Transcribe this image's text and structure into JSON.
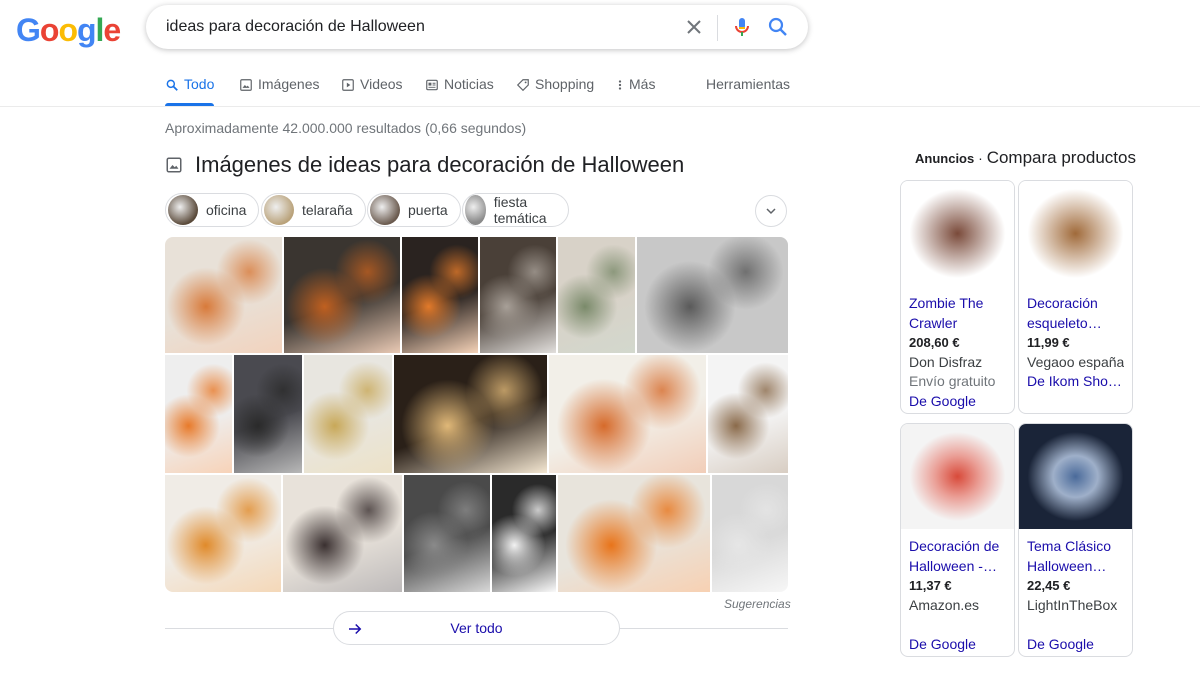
{
  "logo": {
    "letters": [
      "G",
      "o",
      "o",
      "g",
      "l",
      "e"
    ],
    "colors": [
      "#4285F4",
      "#EA4335",
      "#FBBC05",
      "#4285F4",
      "#34A853",
      "#EA4335"
    ]
  },
  "search": {
    "query": "ideas para decoración de Halloween"
  },
  "tabs": [
    {
      "label": "Todo",
      "icon": "search-icon",
      "active": true
    },
    {
      "label": "Imágenes",
      "icon": "image-icon"
    },
    {
      "label": "Videos",
      "icon": "video-icon"
    },
    {
      "label": "Noticias",
      "icon": "news-icon"
    },
    {
      "label": "Shopping",
      "icon": "tag-icon"
    },
    {
      "label": "Más",
      "icon": "more-vert-icon"
    }
  ],
  "tools_label": "Herramientas",
  "result_stats": "Aproximadamente 42.000.000 resultados (0,66 segundos)",
  "images_section": {
    "title": "Imágenes de ideas para decoración de Halloween",
    "chips": [
      {
        "label": "oficina",
        "color": "#5a4a3a"
      },
      {
        "label": "telaraña",
        "color": "#b9a27a"
      },
      {
        "label": "puerta",
        "color": "#6a5a4e"
      },
      {
        "label": "fiesta temática",
        "color": "#8a8a8a"
      }
    ],
    "tiles": [
      {
        "colors": [
          "#e8e1d8",
          "#d87a3a"
        ]
      },
      {
        "colors": [
          "#3a3530",
          "#c06020"
        ]
      },
      {
        "colors": [
          "#2a2320",
          "#e27a2a"
        ]
      },
      {
        "colors": [
          "#4a4038",
          "#a8a098"
        ]
      },
      {
        "colors": [
          "#d8d2c8",
          "#7a8a6a"
        ]
      },
      {
        "colors": [
          "#c8c8c8",
          "#5a5a5a"
        ]
      },
      {
        "colors": [
          "#eeeeee",
          "#e87a2a"
        ]
      },
      {
        "colors": [
          "#4a4a50",
          "#2a2a2a"
        ]
      },
      {
        "colors": [
          "#e8e6e0",
          "#c8a858"
        ]
      },
      {
        "colors": [
          "#2a2018",
          "#e0b878"
        ]
      },
      {
        "colors": [
          "#f2efe8",
          "#d66a2a"
        ]
      },
      {
        "colors": [
          "#f4f4f4",
          "#8a6a4a"
        ]
      },
      {
        "colors": [
          "#f0ece6",
          "#e08a2a"
        ]
      },
      {
        "colors": [
          "#e8e2da",
          "#3a3030"
        ]
      },
      {
        "colors": [
          "#4a4a4a",
          "#8a8a8a"
        ]
      },
      {
        "colors": [
          "#2a2a2a",
          "#f2f2f2"
        ]
      },
      {
        "colors": [
          "#e8e4dc",
          "#e8741a"
        ]
      },
      {
        "colors": [
          "#d8d8d8",
          "#e6e6e6"
        ]
      }
    ],
    "suggestions_label": "Sugerencias",
    "see_all_label": "Ver todo"
  },
  "ads": {
    "label": "Anuncios",
    "separator": "·",
    "heading": "Compara productos",
    "products": [
      {
        "title": "Zombie The Crawler",
        "price": "208,60 €",
        "store": "Don Disfraz",
        "shipping": "Envío gratuito",
        "from": "De Google",
        "img_colors": [
          "#ffffff",
          "#7a4a3a"
        ]
      },
      {
        "title": "Decoración esqueleto…",
        "price": "11,99 €",
        "store": "Vegaoo españa",
        "from": "De Ikom Sho…",
        "img_colors": [
          "#ffffff",
          "#a06a3a"
        ]
      },
      {
        "title": "Decoración de Halloween - 3…",
        "price": "11,37 €",
        "store": "Amazon.es",
        "from": "De Google",
        "img_colors": [
          "#f4f4f4",
          "#d84a3a"
        ]
      },
      {
        "title": "Tema Clásico Halloween…",
        "price": "22,45 €",
        "store": "LightInTheBox",
        "from": "De Google",
        "img_colors": [
          "#1a2438",
          "#4a6a9a"
        ]
      }
    ]
  }
}
